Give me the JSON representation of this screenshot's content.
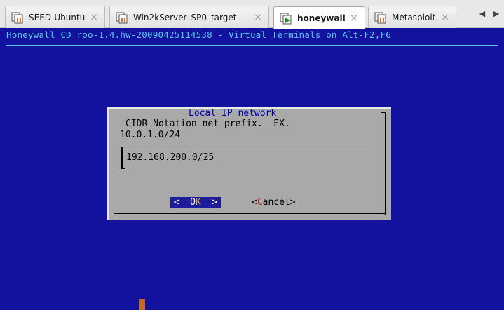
{
  "tabs": [
    {
      "label": "SEED-Ubuntu",
      "close": "×"
    },
    {
      "label": "Win2kServer_SP0_target",
      "close": "×"
    },
    {
      "label": "honeywall",
      "close": "×",
      "active": true
    },
    {
      "label": "Metasploit...",
      "close": "×"
    }
  ],
  "tab_nav": {
    "prev": "◀",
    "next": "▶"
  },
  "terminal": {
    "header": "Honeywall CD roo-1.4.hw-20090425114538 - Virtual Terminals on Alt-F2,F6"
  },
  "dialog": {
    "title": "Local IP network",
    "prompt_line1": "CIDR Notation net prefix.  EX.",
    "prompt_line2": "10.0.1.0/24",
    "input_value": "192.168.200.0/25",
    "ok_left": "<  O",
    "ok_hot": "K",
    "ok_right": "  >",
    "cancel_left": "<",
    "cancel_hot": "C",
    "cancel_right": "ancel>"
  },
  "colors": {
    "console_background": "#12129e",
    "header_text": "#55c8e6",
    "dialog_background": "#a9a9a9",
    "dialog_title": "#0000b0",
    "ok_button_background": "#1d1d9c",
    "cancel_hotkey": "#c81818",
    "cursor": "#c46a1e"
  }
}
